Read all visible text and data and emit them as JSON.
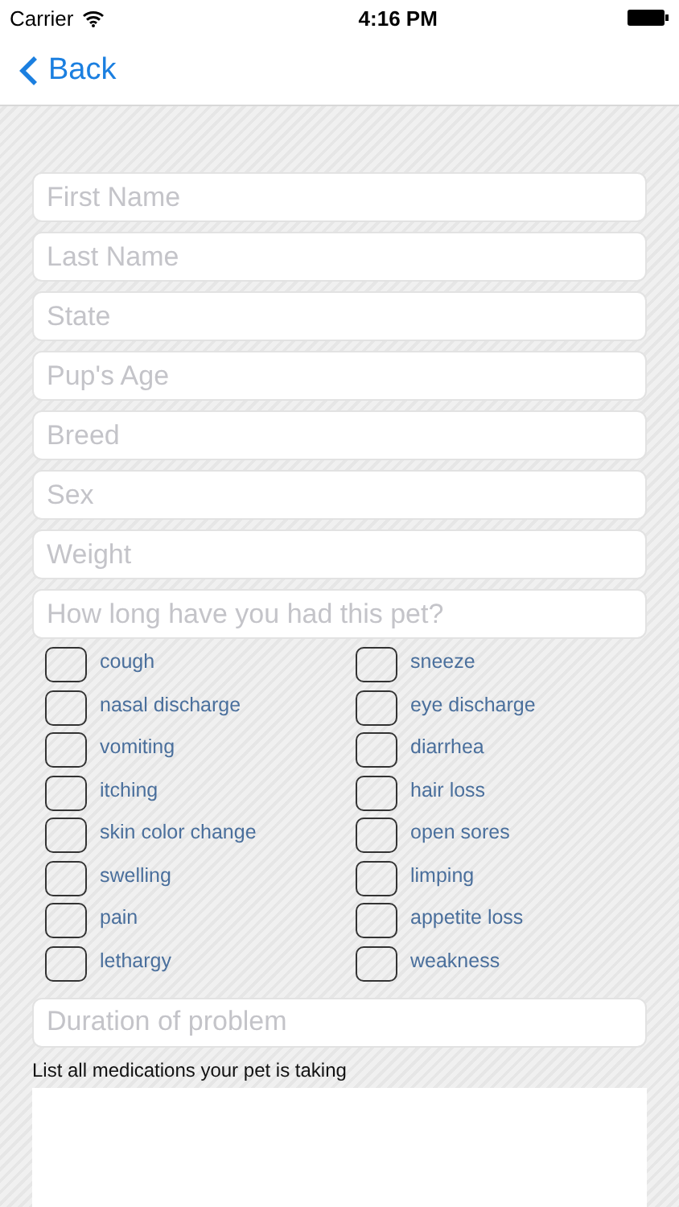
{
  "status_bar": {
    "carrier": "Carrier",
    "time": "4:16 PM"
  },
  "nav": {
    "back": "Back"
  },
  "fields": [
    {
      "placeholder": "First Name"
    },
    {
      "placeholder": "Last Name"
    },
    {
      "placeholder": "State"
    },
    {
      "placeholder": "Pup's Age"
    },
    {
      "placeholder": "Breed"
    },
    {
      "placeholder": "Sex"
    },
    {
      "placeholder": "Weight"
    },
    {
      "placeholder": "How long have you had this pet?"
    }
  ],
  "symptoms": [
    {
      "label": "cough",
      "checked": false
    },
    {
      "label": "sneeze",
      "checked": false
    },
    {
      "label": "nasal discharge",
      "checked": false
    },
    {
      "label": "eye discharge",
      "checked": false
    },
    {
      "label": "vomiting",
      "checked": false
    },
    {
      "label": "diarrhea",
      "checked": false
    },
    {
      "label": "itching",
      "checked": false
    },
    {
      "label": "hair loss",
      "checked": false
    },
    {
      "label": "skin color change",
      "checked": false
    },
    {
      "label": "open sores",
      "checked": false
    },
    {
      "label": "swelling",
      "checked": false
    },
    {
      "label": "limping",
      "checked": false
    },
    {
      "label": "pain",
      "checked": false
    },
    {
      "label": "appetite loss",
      "checked": false
    },
    {
      "label": "lethargy",
      "checked": false
    },
    {
      "label": "weakness",
      "checked": false
    }
  ],
  "duration": {
    "placeholder": "Duration of problem"
  },
  "medications": {
    "label": "List all medications your pet is taking"
  }
}
